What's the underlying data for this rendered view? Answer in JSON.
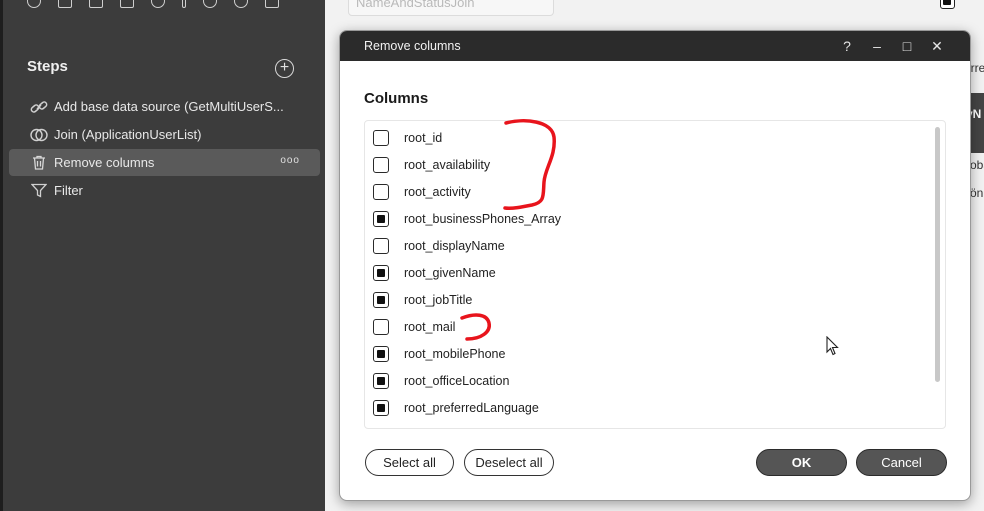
{
  "sidebar": {
    "toolbar_icons": [
      "add-source-icon",
      "text-icon",
      "import-icon",
      "trash-icon",
      "refresh-icon",
      "pin-icon",
      "list-icon",
      "join-icon",
      "table-icon"
    ],
    "title": "Steps",
    "add_step_icon": "plus-circle-icon",
    "steps": [
      {
        "label": "Add base data source (GetMultiUserS...",
        "icon": "link-icon",
        "active": false
      },
      {
        "label": "Join (ApplicationUserList)",
        "icon": "join-icon",
        "active": false
      },
      {
        "label": "Remove columns",
        "icon": "trash-icon",
        "active": true
      },
      {
        "label": "Filter",
        "icon": "filter-icon",
        "active": false
      }
    ],
    "more_label": "ooo"
  },
  "background": {
    "input_value": "NameAndStatusJoin",
    "fragments": [
      "urre",
      "yN",
      "oba",
      "ön"
    ]
  },
  "dialog": {
    "title": "Remove columns",
    "window_buttons": {
      "help": "?",
      "minimize": "–",
      "maximize": "□",
      "close": "✕"
    },
    "heading": "Columns",
    "columns": [
      {
        "label": "root_id",
        "checked": false
      },
      {
        "label": "root_availability",
        "checked": false
      },
      {
        "label": "root_activity",
        "checked": false
      },
      {
        "label": "root_businessPhones_Array",
        "checked": true
      },
      {
        "label": "root_displayName",
        "checked": false
      },
      {
        "label": "root_givenName",
        "checked": true
      },
      {
        "label": "root_jobTitle",
        "checked": true
      },
      {
        "label": "root_mail",
        "checked": false
      },
      {
        "label": "root_mobilePhone",
        "checked": true
      },
      {
        "label": "root_officeLocation",
        "checked": true
      },
      {
        "label": "root_preferredLanguage",
        "checked": true
      }
    ],
    "buttons": {
      "select_all": "Select all",
      "deselect_all": "Deselect all",
      "ok": "OK",
      "cancel": "Cancel"
    }
  },
  "colors": {
    "sidebar_bg": "#3c3c3c",
    "titlebar_bg": "#2b2b2b",
    "annotation": "#e8141c",
    "primary_button": "#555555"
  }
}
